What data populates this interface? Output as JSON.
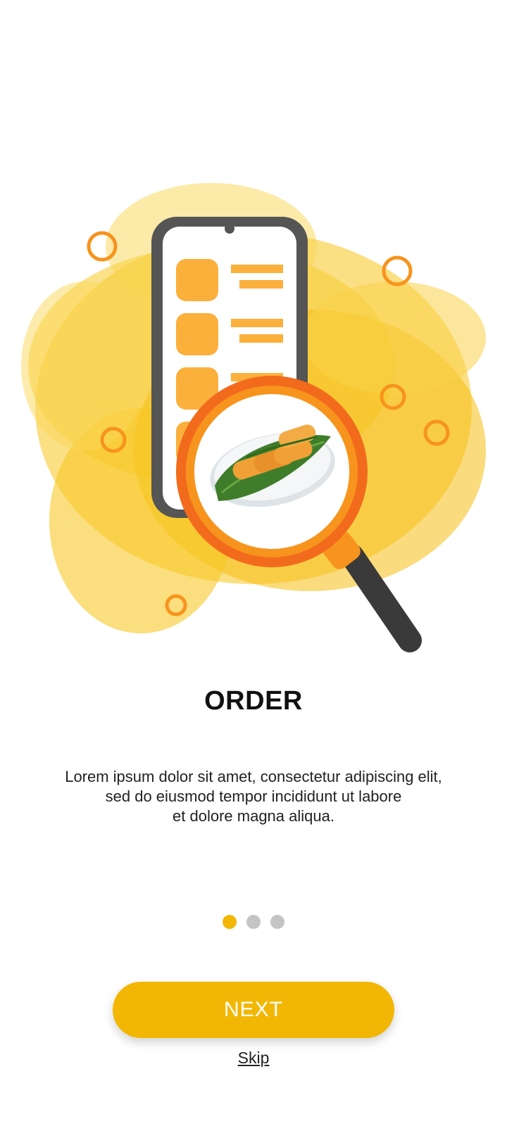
{
  "onboarding": {
    "title": "ORDER",
    "description_lines": [
      "Lorem ipsum dolor sit amet, consectetur adipiscing elit,",
      "sed do eiusmod tempor incididunt ut labore",
      "et dolore magna aliqua."
    ],
    "pager": {
      "current": 1,
      "total": 3
    },
    "next_label": "NEXT",
    "skip_label": "Skip"
  },
  "illustration": {
    "subject": "phone-menu-with-magnifier-over-spring-rolls",
    "icons": [
      "smartphone-icon",
      "magnifier-icon",
      "spring-rolls-dish"
    ]
  },
  "colors": {
    "accent": "#f2b705",
    "dot_inactive": "#c4c4c4",
    "splash": "#f7c51e",
    "menu_item": "#fbb03b",
    "magnifier_ring": "#f26b1d",
    "phone_frame": "#555555"
  }
}
